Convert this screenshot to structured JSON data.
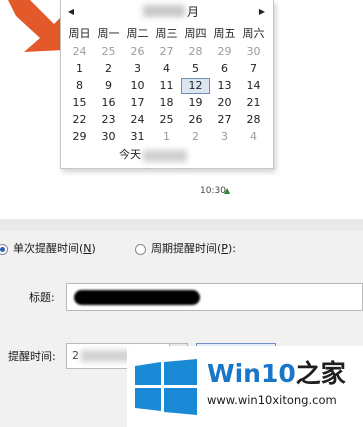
{
  "calendar": {
    "month_title": "月",
    "prev_icon": "triangle-left-icon",
    "next_icon": "triangle-right-icon",
    "weekdays": [
      "周日",
      "周一",
      "周二",
      "周三",
      "周四",
      "周五",
      "周六"
    ],
    "weeks": [
      [
        "24",
        "25",
        "26",
        "27",
        "28",
        "29",
        "30"
      ],
      [
        "1",
        "2",
        "3",
        "4",
        "5",
        "6",
        "7"
      ],
      [
        "8",
        "9",
        "10",
        "11",
        "12",
        "13",
        "14"
      ],
      [
        "15",
        "16",
        "17",
        "18",
        "19",
        "20",
        "21"
      ],
      [
        "22",
        "23",
        "24",
        "25",
        "26",
        "27",
        "28"
      ],
      [
        "29",
        "30",
        "31",
        "1",
        "2",
        "3",
        "4"
      ]
    ],
    "selected_day": "12",
    "today_label": "今天"
  },
  "reminder": {
    "single_option": {
      "label": "单次提醒时间",
      "shortcut": "N",
      "selected": true
    },
    "periodic_option": {
      "label": "周期提醒时间",
      "shortcut": "P",
      "selected": false
    },
    "title_label": "标题:",
    "remind_time_label": "提醒时间:",
    "date_value_prefix": "2",
    "time_value": "10:30"
  },
  "watermark": {
    "brand_prefix": "Win10",
    "brand_suffix": "之家",
    "url": "www.win10xitong.com"
  },
  "colors": {
    "arrow": "#e3592a",
    "radio_selected": "#2b63b5",
    "time_field_border": "#6f90c2",
    "brand_blue": "#1976c8"
  }
}
